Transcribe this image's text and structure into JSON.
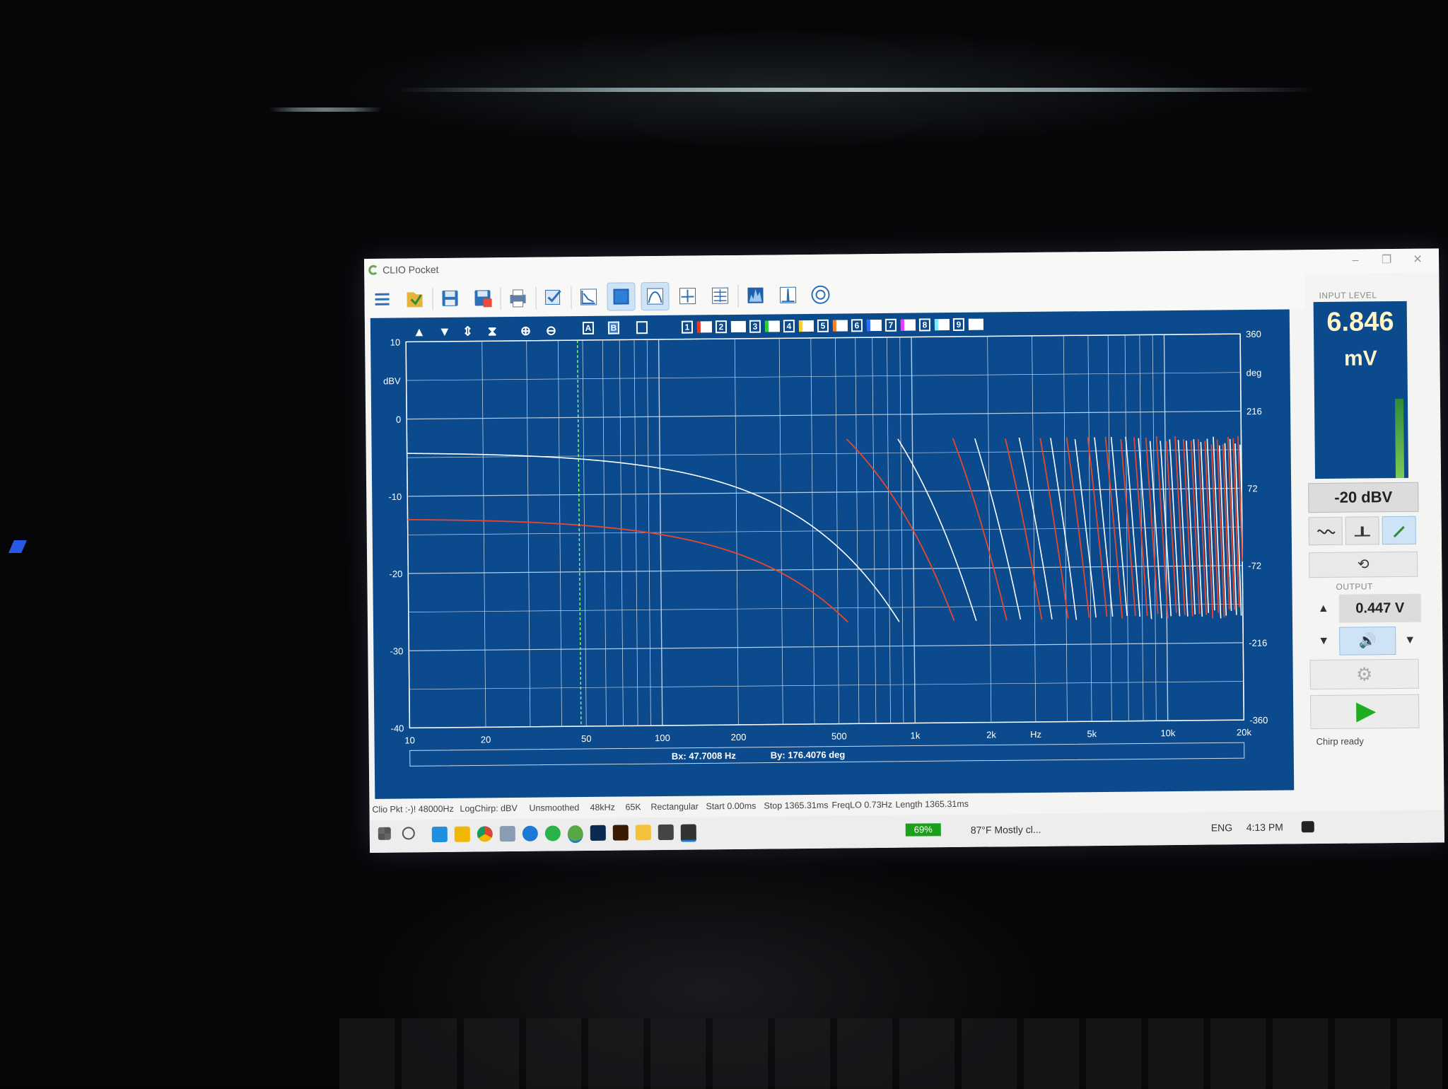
{
  "window": {
    "title": "CLIO Pocket",
    "controls": [
      "–",
      "❐",
      "✕"
    ]
  },
  "toolbar": {
    "buttons": [
      {
        "name": "menu-icon"
      },
      {
        "name": "open-file-icon"
      },
      {
        "name": "save-icon"
      },
      {
        "name": "save-as-icon"
      },
      {
        "name": "print-icon"
      },
      {
        "name": "check-icon"
      },
      {
        "name": "fft-icon"
      },
      {
        "name": "sinusoidal-icon"
      },
      {
        "name": "frequency-response-icon"
      },
      {
        "name": "impulse-icon"
      },
      {
        "name": "waterfall-icon"
      },
      {
        "name": "spectrum-icon"
      },
      {
        "name": "peak-icon"
      },
      {
        "name": "polar-icon"
      }
    ],
    "right_icons": [
      "ruler-icon",
      "lifebuoy-icon"
    ]
  },
  "graph_tools": {
    "nav": [
      "▲",
      "▼",
      "⇕",
      "⧗",
      "⊕",
      "⊖"
    ],
    "cursor_a": "A",
    "cursor_b": "B",
    "memories": [
      "1",
      "2",
      "3",
      "4",
      "5",
      "6",
      "7",
      "8",
      "9"
    ],
    "memory_colors": [
      "#e03a2a",
      "#ffffff",
      "#2ecc40",
      "#f4d03f",
      "#f08030",
      "#2f6bff",
      "#e040fb",
      "#7fe9ff",
      "#ffffff"
    ]
  },
  "chart_data": {
    "type": "line",
    "xlabel": "Hz",
    "ylabel": "dBV",
    "ylabel_right": "deg",
    "x_scale": "log",
    "xlim": [
      10,
      20000
    ],
    "ylim": [
      -40,
      10
    ],
    "y2lim": [
      -360,
      360
    ],
    "x_ticks": [
      "10",
      "20",
      "50",
      "100",
      "200",
      "500",
      "1k",
      "2k",
      "5k",
      "10k",
      "20k"
    ],
    "y_ticks": [
      "10",
      "0",
      "-10",
      "-20",
      "-30",
      "-40"
    ],
    "y2_ticks": [
      "360",
      "216",
      "72",
      "-72",
      "-216",
      "-360"
    ],
    "grid": true,
    "cursor_x": 47.7008,
    "series": [
      {
        "color": "#ffffff"
      },
      {
        "color": "#e8472e"
      }
    ]
  },
  "cursor_readout": {
    "bx": "Bx: 47.7008 Hz",
    "by": "By: 176.4076 deg"
  },
  "status_bar": [
    "Clio Pkt :-)! 48000Hz",
    "LogChirp: dBV",
    "Unsmoothed",
    "48kHz",
    "65K",
    "Rectangular",
    "Start 0.00ms",
    "Stop 1365.31ms",
    "FreqLO 0.73Hz",
    "Length 1365.31ms"
  ],
  "panel": {
    "input_label": "INPUT LEVEL",
    "input_value": "6.846",
    "input_unit": "mV",
    "input_level_fraction": 0.45,
    "range": "-20 dBV",
    "output_label": "OUTPUT",
    "output_value": "0.447 V",
    "status": "Chirp ready",
    "loop_glyph": "⟲",
    "gear_glyph": "⚙",
    "speaker_glyph": "🔊",
    "up_glyph": "▲",
    "down_glyph": "▼"
  },
  "taskbar": {
    "battery": "69%",
    "weather": "87°F  Mostly cl...",
    "language": "ENG",
    "time": "4:13 PM"
  }
}
